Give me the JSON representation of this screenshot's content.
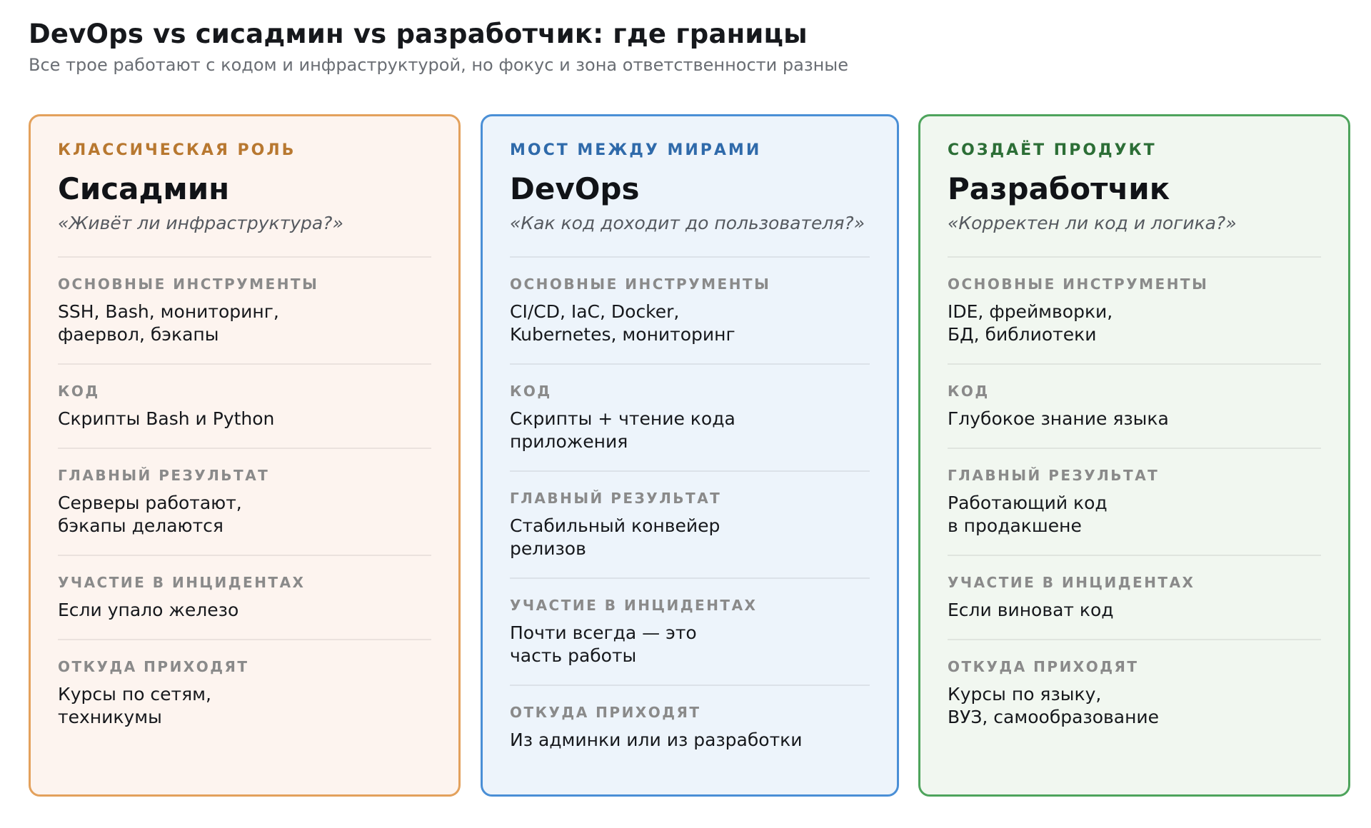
{
  "header": {
    "title": "DevOps vs сисадмин vs разработчик: где границы",
    "subtitle": "Все трое работают с кодом и инфраструктурой, но фокус и зона ответственности разные"
  },
  "colors": {
    "sysadmin_border": "#e3a15c",
    "sysadmin_bg": "#fdf4ef",
    "sysadmin_tag": "#b87830",
    "devops_border": "#4a8fd6",
    "devops_bg": "#edf4fb",
    "devops_tag": "#2f6aaa",
    "dev_border": "#4ea45c",
    "dev_bg": "#f1f7f0",
    "dev_tag": "#2c6e36"
  },
  "cards": [
    {
      "tag": "КЛАССИЧЕСКАЯ РОЛЬ",
      "title": "Сисадмин",
      "quote": "«Живёт ли инфраструктура?»",
      "sections": [
        {
          "label": "ОСНОВНЫЕ ИНСТРУМЕНТЫ",
          "value": "SSH, Bash, мониторинг,\nфаервол, бэкапы"
        },
        {
          "label": "КОД",
          "value": "Скрипты Bash и Python"
        },
        {
          "label": "ГЛАВНЫЙ РЕЗУЛЬТАТ",
          "value": "Серверы работают,\nбэкапы делаются"
        },
        {
          "label": "УЧАСТИЕ В ИНЦИДЕНТАХ",
          "value": "Если упало железо"
        },
        {
          "label": "ОТКУДА ПРИХОДЯТ",
          "value": "Курсы по сетям,\nтехникумы"
        }
      ]
    },
    {
      "tag": "МОСТ МЕЖДУ МИРАМИ",
      "title": "DevOps",
      "quote": "«Как код доходит до пользователя?»",
      "sections": [
        {
          "label": "ОСНОВНЫЕ ИНСТРУМЕНТЫ",
          "value": "CI/CD, IaC, Docker,\nKubernetes, мониторинг"
        },
        {
          "label": "КОД",
          "value": "Скрипты + чтение кода\nприложения"
        },
        {
          "label": "ГЛАВНЫЙ РЕЗУЛЬТАТ",
          "value": "Стабильный конвейер\nрелизов"
        },
        {
          "label": "УЧАСТИЕ В ИНЦИДЕНТАХ",
          "value": "Почти всегда — это\nчасть работы"
        },
        {
          "label": "ОТКУДА ПРИХОДЯТ",
          "value": "Из админки или из разработки"
        }
      ]
    },
    {
      "tag": "СОЗДАЁТ ПРОДУКТ",
      "title": "Разработчик",
      "quote": "«Корректен ли код и логика?»",
      "sections": [
        {
          "label": "ОСНОВНЫЕ ИНСТРУМЕНТЫ",
          "value": "IDE, фреймворки,\nБД, библиотеки"
        },
        {
          "label": "КОД",
          "value": "Глубокое знание языка"
        },
        {
          "label": "ГЛАВНЫЙ РЕЗУЛЬТАТ",
          "value": "Работающий код\nв продакшене"
        },
        {
          "label": "УЧАСТИЕ В ИНЦИДЕНТАХ",
          "value": "Если виноват код"
        },
        {
          "label": "ОТКУДА ПРИХОДЯТ",
          "value": "Курсы по языку,\nВУЗ, самообразование"
        }
      ]
    }
  ]
}
